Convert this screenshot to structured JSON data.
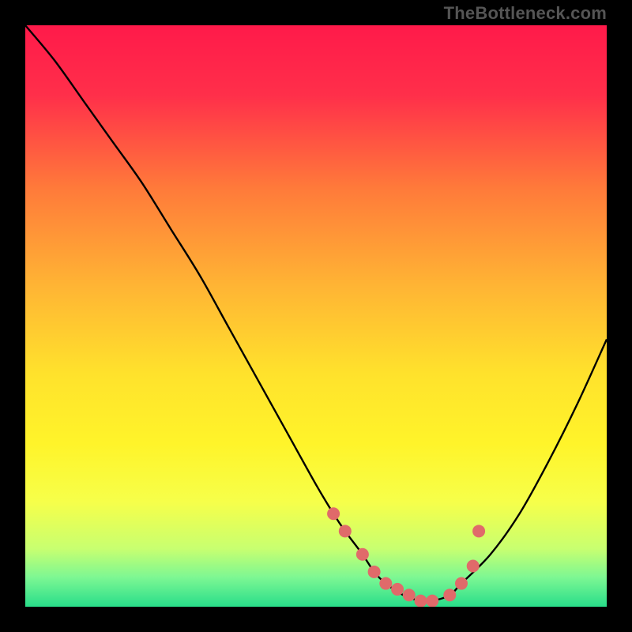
{
  "watermark": "TheBottleneck.com",
  "chart_data": {
    "type": "line",
    "title": "",
    "xlabel": "",
    "ylabel": "",
    "xlim": [
      0,
      100
    ],
    "ylim": [
      0,
      100
    ],
    "grid": false,
    "legend": false,
    "series": [
      {
        "name": "bottleneck-curve",
        "x": [
          0,
          5,
          10,
          15,
          20,
          25,
          30,
          35,
          40,
          45,
          50,
          53,
          55,
          58,
          60,
          62,
          65,
          68,
          70,
          73,
          75,
          80,
          85,
          90,
          95,
          100
        ],
        "y": [
          100,
          94,
          87,
          80,
          73,
          65,
          57,
          48,
          39,
          30,
          21,
          16,
          13,
          9,
          6,
          4,
          2,
          1,
          1,
          2,
          4,
          9,
          16,
          25,
          35,
          46
        ],
        "color": "#000000"
      }
    ],
    "markers": {
      "name": "near-minimum-markers",
      "color": "#e06a6a",
      "radius_px": 8,
      "points_x": [
        53,
        55,
        58,
        60,
        62,
        64,
        66,
        68,
        70,
        73,
        75,
        77,
        78
      ],
      "points_y": [
        16,
        13,
        9,
        6,
        4,
        3,
        2,
        1,
        1,
        2,
        4,
        7,
        13
      ]
    },
    "background_gradient": {
      "stops": [
        {
          "offset": 0.0,
          "color": "#ff1a4a"
        },
        {
          "offset": 0.12,
          "color": "#ff2f4a"
        },
        {
          "offset": 0.28,
          "color": "#ff7a3a"
        },
        {
          "offset": 0.45,
          "color": "#ffb534"
        },
        {
          "offset": 0.6,
          "color": "#ffe22c"
        },
        {
          "offset": 0.72,
          "color": "#fff42a"
        },
        {
          "offset": 0.82,
          "color": "#f6ff4a"
        },
        {
          "offset": 0.9,
          "color": "#c8ff70"
        },
        {
          "offset": 0.95,
          "color": "#7cf793"
        },
        {
          "offset": 1.0,
          "color": "#28dd8a"
        }
      ]
    }
  }
}
